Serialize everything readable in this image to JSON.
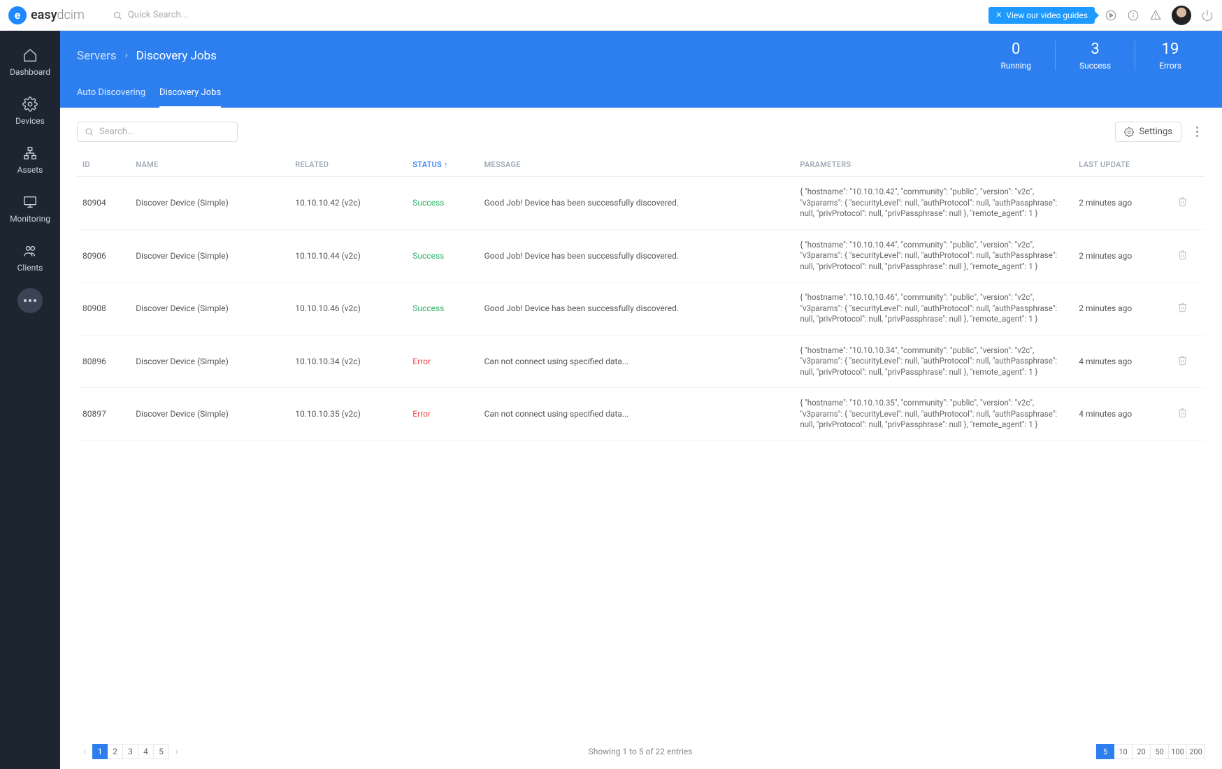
{
  "brand": {
    "text_bold": "easy",
    "text_thin": "dcim"
  },
  "quicksearch_placeholder": "Quick Search...",
  "video_guides_label": "View our video guides",
  "sidebar": {
    "items": [
      {
        "label": "Dashboard"
      },
      {
        "label": "Devices"
      },
      {
        "label": "Assets"
      },
      {
        "label": "Monitoring"
      },
      {
        "label": "Clients"
      }
    ]
  },
  "breadcrumb": {
    "parent": "Servers",
    "current": "Discovery Jobs"
  },
  "stats": [
    {
      "num": "0",
      "label": "Running"
    },
    {
      "num": "3",
      "label": "Success"
    },
    {
      "num": "19",
      "label": "Errors"
    }
  ],
  "tabs": [
    {
      "label": "Auto Discovering",
      "active": false
    },
    {
      "label": "Discovery Jobs",
      "active": true
    }
  ],
  "table_search_placeholder": "Search...",
  "settings_label": "Settings",
  "columns": {
    "id": "ID",
    "name": "NAME",
    "related": "RELATED",
    "status": "STATUS",
    "message": "MESSAGE",
    "parameters": "PARAMETERS",
    "last_update": "LAST UPDATE"
  },
  "rows": [
    {
      "id": "80904",
      "name": "Discover Device (Simple)",
      "related": "10.10.10.42 (v2c)",
      "status": "Success",
      "status_class": "status-success",
      "message": "Good Job! Device has been successfully discovered.",
      "parameters": "{ \"hostname\": \"10.10.10.42\", \"community\": \"public\", \"version\": \"v2c\", \"v3params\": { \"securityLevel\": null, \"authProtocol\": null, \"authPassphrase\": null, \"privProtocol\": null, \"privPassphrase\": null }, \"remote_agent\": 1 }",
      "last_update": "2 minutes ago"
    },
    {
      "id": "80906",
      "name": "Discover Device (Simple)",
      "related": "10.10.10.44 (v2c)",
      "status": "Success",
      "status_class": "status-success",
      "message": "Good Job! Device has been successfully discovered.",
      "parameters": "{ \"hostname\": \"10.10.10.44\", \"community\": \"public\", \"version\": \"v2c\", \"v3params\": { \"securityLevel\": null, \"authProtocol\": null, \"authPassphrase\": null, \"privProtocol\": null, \"privPassphrase\": null }, \"remote_agent\": 1 }",
      "last_update": "2 minutes ago"
    },
    {
      "id": "80908",
      "name": "Discover Device (Simple)",
      "related": "10.10.10.46 (v2c)",
      "status": "Success",
      "status_class": "status-success",
      "message": "Good Job! Device has been successfully discovered.",
      "parameters": "{ \"hostname\": \"10.10.10.46\", \"community\": \"public\", \"version\": \"v2c\", \"v3params\": { \"securityLevel\": null, \"authProtocol\": null, \"authPassphrase\": null, \"privProtocol\": null, \"privPassphrase\": null }, \"remote_agent\": 1 }",
      "last_update": "2 minutes ago"
    },
    {
      "id": "80896",
      "name": "Discover Device (Simple)",
      "related": "10.10.10.34 (v2c)",
      "status": "Error",
      "status_class": "status-error",
      "message": "Can not connect using specified data...",
      "parameters": "{ \"hostname\": \"10.10.10.34\", \"community\": \"public\", \"version\": \"v2c\", \"v3params\": { \"securityLevel\": null, \"authProtocol\": null, \"authPassphrase\": null, \"privProtocol\": null, \"privPassphrase\": null }, \"remote_agent\": 1 }",
      "last_update": "4 minutes ago"
    },
    {
      "id": "80897",
      "name": "Discover Device (Simple)",
      "related": "10.10.10.35 (v2c)",
      "status": "Error",
      "status_class": "status-error",
      "message": "Can not connect using specified data...",
      "parameters": "{ \"hostname\": \"10.10.10.35\", \"community\": \"public\", \"version\": \"v2c\", \"v3params\": { \"securityLevel\": null, \"authProtocol\": null, \"authPassphrase\": null, \"privProtocol\": null, \"privPassphrase\": null }, \"remote_agent\": 1 }",
      "last_update": "4 minutes ago"
    }
  ],
  "pagination": {
    "pages": [
      "1",
      "2",
      "3",
      "4",
      "5"
    ],
    "active_page": "1",
    "entries_info": "Showing 1 to 5 of 22 entries",
    "per_page_options": [
      "5",
      "10",
      "20",
      "50",
      "100",
      "200"
    ],
    "active_per_page": "5"
  }
}
